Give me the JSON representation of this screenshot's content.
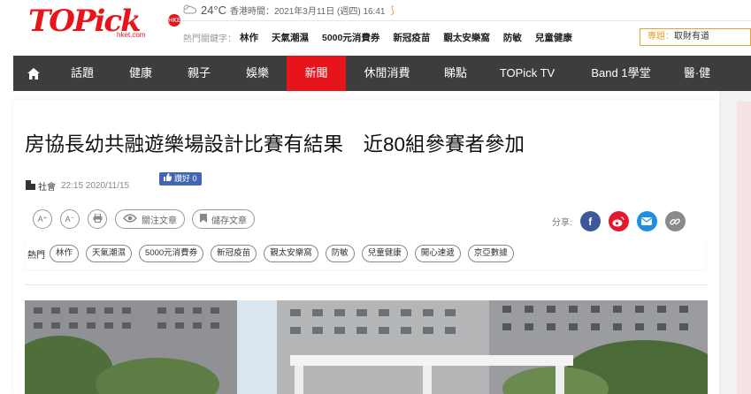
{
  "header": {
    "logo_text": "TOPick",
    "logo_sub": "hket.com",
    "logo_badge": "HKET",
    "weather": {
      "temp": "24°C",
      "label": "香港時間：",
      "datetime": "2021年3月11日 (週四) 16:41"
    },
    "hot_label": "熱門關鍵字：",
    "hot_keywords": [
      "林作",
      "天氣潮濕",
      "5000元消費券",
      "新冠疫苗",
      "覲太安樂窩",
      "防敏",
      "兒童健康"
    ],
    "topic_label": "專題：",
    "topic_value": "取財有道"
  },
  "nav": {
    "items": [
      "話題",
      "健康",
      "親子",
      "娛樂",
      "新聞",
      "休閒消費",
      "睇點",
      "TOPick TV",
      "Band 1學堂",
      "醫·健"
    ],
    "active": "新聞"
  },
  "article": {
    "title": "房協長幼共融遊樂場設計比賽有結果　近80組參賽者參加",
    "category": "社會",
    "time": "22:15 2020/11/15",
    "like_label": "讚好 0",
    "font_up": "A⁺",
    "font_down": "A⁻",
    "follow_label": "關注文章",
    "save_label": "儲存文章",
    "share_label": "分享:",
    "tags_label": "熱門",
    "tags": [
      "林作",
      "天氣潮濕",
      "5000元消費券",
      "新冠疫苗",
      "覲太安樂窩",
      "防敏",
      "兒童健康",
      "開心速遞",
      "京亞數據"
    ]
  },
  "colors": {
    "brand": "#e8141b",
    "nav_bg": "#3d3d3d",
    "facebook": "#3b5998",
    "weibo": "#e6162d",
    "email": "#1f8fe5",
    "link": "#8a8a8a"
  }
}
